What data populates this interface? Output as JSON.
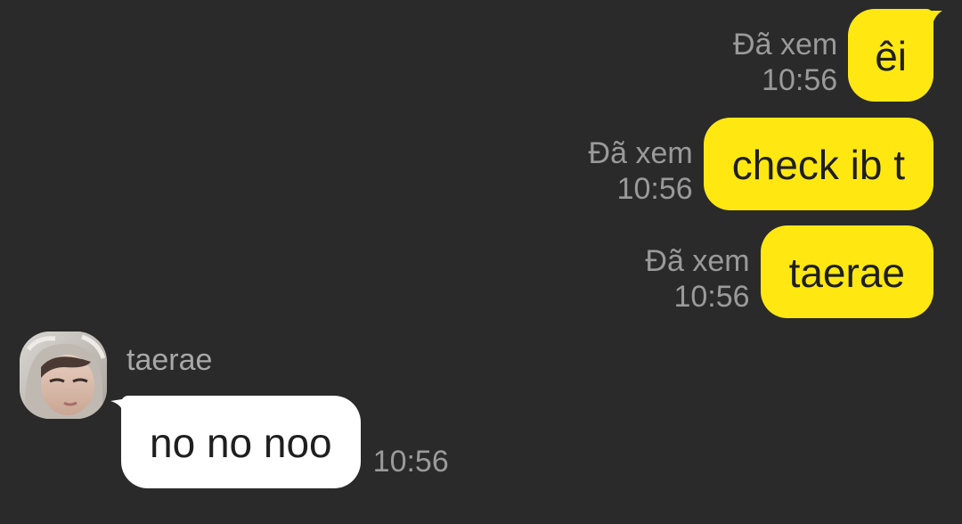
{
  "theme": {
    "background": "#2a2a2a",
    "outgoing_bubble": "#ffe812",
    "incoming_bubble": "#ffffff",
    "meta_text": "#9a9a9a"
  },
  "outgoing": [
    {
      "status": "Đã xem",
      "time": "10:56",
      "text": "êi"
    },
    {
      "status": "Đã xem",
      "time": "10:56",
      "text": "check ib t"
    },
    {
      "status": "Đã xem",
      "time": "10:56",
      "text": "taerae"
    }
  ],
  "incoming": {
    "sender": "taerae",
    "avatar_icon": "avatar-photo",
    "message": {
      "text": "no no noo",
      "time": "10:56"
    }
  }
}
